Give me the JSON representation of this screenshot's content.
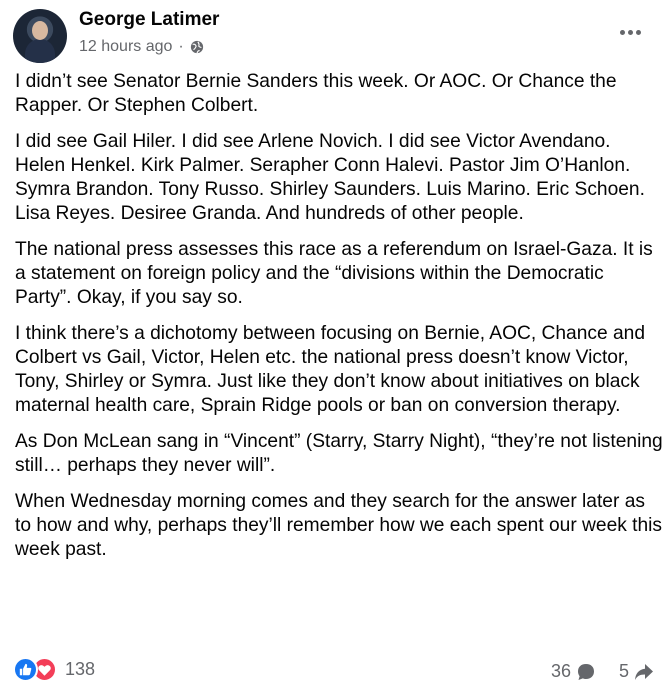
{
  "post": {
    "author": "George Latimer",
    "time": "12 hours ago",
    "separator": "·",
    "paragraphs": [
      "I didn’t see Senator Bernie Sanders this week. Or AOC. Or Chance the Rapper. Or Stephen Colbert.",
      "I did see Gail Hiler. I did see Arlene Novich. I did see Victor Avendano. Helen Henkel. Kirk Palmer. Serapher Conn Halevi. Pastor Jim O’Hanlon. Symra Brandon. Tony Russo. Shirley Saunders. Luis Marino. Eric Schoen. Lisa Reyes. Desiree Granda. And hundreds of other people.",
      "The national press assesses this race as a referendum on Israel-Gaza. It is a statement on foreign policy and the “divisions within the Democratic Party”. Okay, if you say so.",
      "I think there’s a dichotomy between focusing on Bernie, AOC, Chance and Colbert vs Gail, Victor, Helen etc. the national press doesn’t know Victor, Tony, Shirley or Symra. Just like they don’t know about initiatives on black maternal health care, Sprain Ridge pools or ban on conversion therapy.",
      "As Don McLean sang in “Vincent” (Starry, Starry Night), “they’re not listening still… perhaps they never will”.",
      "When Wednesday morning comes and they search for the answer later as to how and why, perhaps they’ll remember how we each spent our week this week past."
    ]
  },
  "engagement": {
    "reactions_count": "138",
    "comments_count": "36",
    "shares_count": "5"
  },
  "icons": {
    "privacy": "globe-icon",
    "more": "more-options-icon",
    "reaction_1": "like-icon",
    "reaction_2": "love-icon",
    "comments": "comment-bubble-icon",
    "shares": "share-arrow-icon"
  },
  "colors": {
    "like": "#1877f2",
    "love": "#f33e58",
    "secondary_text": "#65676b"
  }
}
